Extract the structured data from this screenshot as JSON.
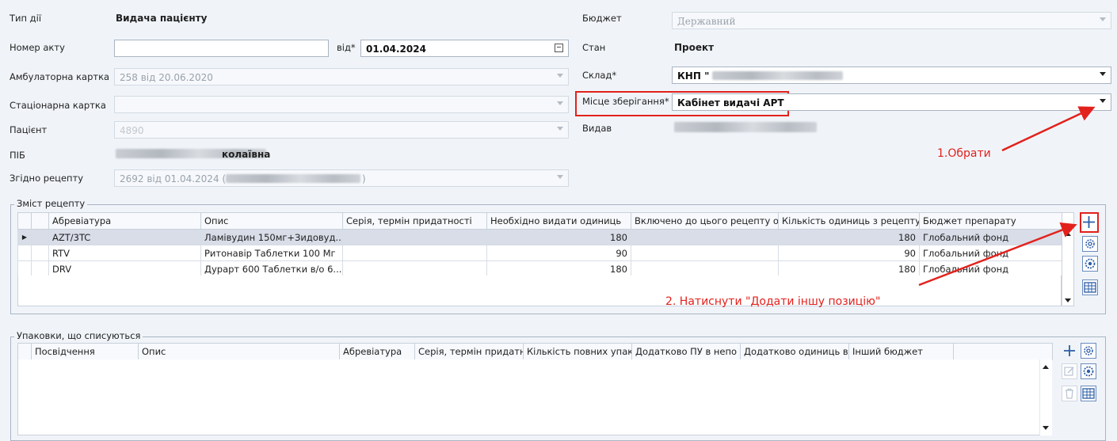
{
  "form": {
    "action_type_label": "Тип дії",
    "action_type_value": "Видача пацієнту",
    "act_number_label": "Номер акту",
    "act_number_value": "",
    "from_label": "від*",
    "date_value": "01.04.2024",
    "outpatient_card_label": "Амбулаторна картка",
    "outpatient_card_value": "258 від 20.06.2020",
    "inpatient_card_label": "Стаціонарна картка",
    "inpatient_card_value": "",
    "patient_label": "Пацієнт",
    "patient_value": "4890",
    "full_name_label": "ПІБ",
    "full_name_value": "колаївна",
    "prescription_label": "Згідно рецепту",
    "prescription_value_start": "2692 від 01.04.2024 (",
    "prescription_value_end": ")",
    "budget_label": "Бюджет",
    "budget_value": "Державний",
    "state_label": "Стан",
    "state_value": "Проект",
    "warehouse_label": "Склад*",
    "warehouse_value": "КНП \"",
    "storage_label": "Місце зберігання*",
    "storage_value": "Кабінет видачі АРТ",
    "issued_by_label": "Видав"
  },
  "prescription_group": {
    "title": "Зміст рецепту",
    "columns": [
      "Абревіатура",
      "Опис",
      "Серія, термін придатності",
      "Необхідно видати одиниць",
      "Включено до цього рецепту о",
      "Кількість одиниць з рецепту",
      "Бюджет препарату"
    ],
    "rows": [
      {
        "abbr": "AZT/3TC",
        "desc": "Ламівудин 150мг+Зидовуд...",
        "series": "",
        "needed": "180",
        "included": "",
        "qty": "180",
        "budget": "Глобальний фонд"
      },
      {
        "abbr": "RTV",
        "desc": "Ритонавір Таблетки 100 Мг",
        "series": "",
        "needed": "90",
        "included": "",
        "qty": "90",
        "budget": "Глобальний фонд"
      },
      {
        "abbr": "DRV",
        "desc": "Дурарт 600 Таблетки в/о 6...",
        "series": "",
        "needed": "180",
        "included": "",
        "qty": "180",
        "budget": "Глобальний фонд"
      }
    ]
  },
  "packages_group": {
    "title": "Упаковки, що списуються",
    "columns": [
      "Посвідчення",
      "Опис",
      "Абревіатура",
      "Серія, термін придатн",
      "Кількість повних упак",
      "Додатково ПУ в непо",
      "Додатково одиниць в",
      "Інший бюджет"
    ]
  },
  "annotations": {
    "step1": "1.Обрати",
    "step2": "2. Натиснути \"Додати іншу позицію\"",
    "color": "#e2211c"
  },
  "icons": {
    "add": "plus-icon",
    "settings": "gear-icon",
    "excel": "excel-icon",
    "edit": "edit-icon",
    "delete": "trash-icon",
    "calendar": "calendar-icon"
  }
}
